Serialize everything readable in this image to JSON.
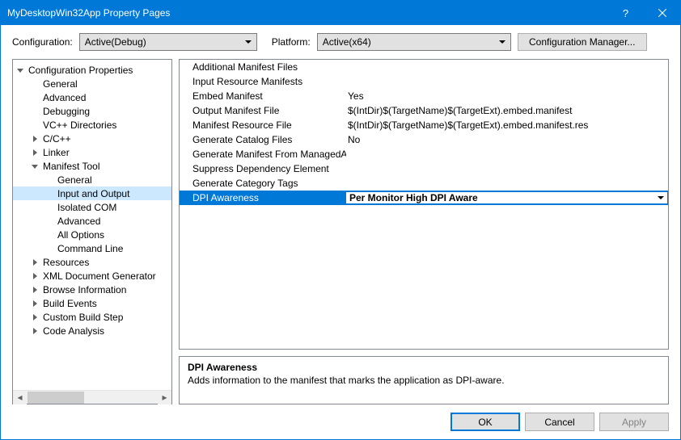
{
  "window": {
    "title": "MyDesktopWin32App Property Pages",
    "help_label": "?",
    "close_label": "x"
  },
  "toolbar": {
    "configuration_label": "Configuration:",
    "configuration_value": "Active(Debug)",
    "platform_label": "Platform:",
    "platform_value": "Active(x64)",
    "configuration_manager_label": "Configuration Manager..."
  },
  "tree": {
    "items": [
      {
        "depth": 1,
        "expander": "down",
        "label": "Configuration Properties"
      },
      {
        "depth": 2,
        "expander": "none",
        "label": "General"
      },
      {
        "depth": 2,
        "expander": "none",
        "label": "Advanced"
      },
      {
        "depth": 2,
        "expander": "none",
        "label": "Debugging"
      },
      {
        "depth": 2,
        "expander": "none",
        "label": "VC++ Directories"
      },
      {
        "depth": 2,
        "expander": "right",
        "label": "C/C++"
      },
      {
        "depth": 2,
        "expander": "right",
        "label": "Linker"
      },
      {
        "depth": 2,
        "expander": "down",
        "label": "Manifest Tool"
      },
      {
        "depth": 3,
        "expander": "none",
        "label": "General"
      },
      {
        "depth": 3,
        "expander": "none",
        "label": "Input and Output",
        "selected": true
      },
      {
        "depth": 3,
        "expander": "none",
        "label": "Isolated COM"
      },
      {
        "depth": 3,
        "expander": "none",
        "label": "Advanced"
      },
      {
        "depth": 3,
        "expander": "none",
        "label": "All Options"
      },
      {
        "depth": 3,
        "expander": "none",
        "label": "Command Line"
      },
      {
        "depth": 2,
        "expander": "right",
        "label": "Resources"
      },
      {
        "depth": 2,
        "expander": "right",
        "label": "XML Document Generator"
      },
      {
        "depth": 2,
        "expander": "right",
        "label": "Browse Information"
      },
      {
        "depth": 2,
        "expander": "right",
        "label": "Build Events"
      },
      {
        "depth": 2,
        "expander": "right",
        "label": "Custom Build Step"
      },
      {
        "depth": 2,
        "expander": "right",
        "label": "Code Analysis"
      }
    ]
  },
  "grid": {
    "rows": [
      {
        "name": "Additional Manifest Files",
        "value": ""
      },
      {
        "name": "Input Resource Manifests",
        "value": ""
      },
      {
        "name": "Embed Manifest",
        "value": "Yes"
      },
      {
        "name": "Output Manifest File",
        "value": "$(IntDir)$(TargetName)$(TargetExt).embed.manifest"
      },
      {
        "name": "Manifest Resource File",
        "value": "$(IntDir)$(TargetName)$(TargetExt).embed.manifest.res"
      },
      {
        "name": "Generate Catalog Files",
        "value": "No"
      },
      {
        "name": "Generate Manifest From ManagedAssembly",
        "value": ""
      },
      {
        "name": "Suppress Dependency Element",
        "value": ""
      },
      {
        "name": "Generate Category Tags",
        "value": ""
      },
      {
        "name": "DPI Awareness",
        "value": "Per Monitor High DPI Aware",
        "selected": true
      }
    ]
  },
  "description": {
    "title": "DPI Awareness",
    "text": "Adds information to the manifest that marks the application as DPI-aware."
  },
  "buttons": {
    "ok": "OK",
    "cancel": "Cancel",
    "apply": "Apply"
  }
}
